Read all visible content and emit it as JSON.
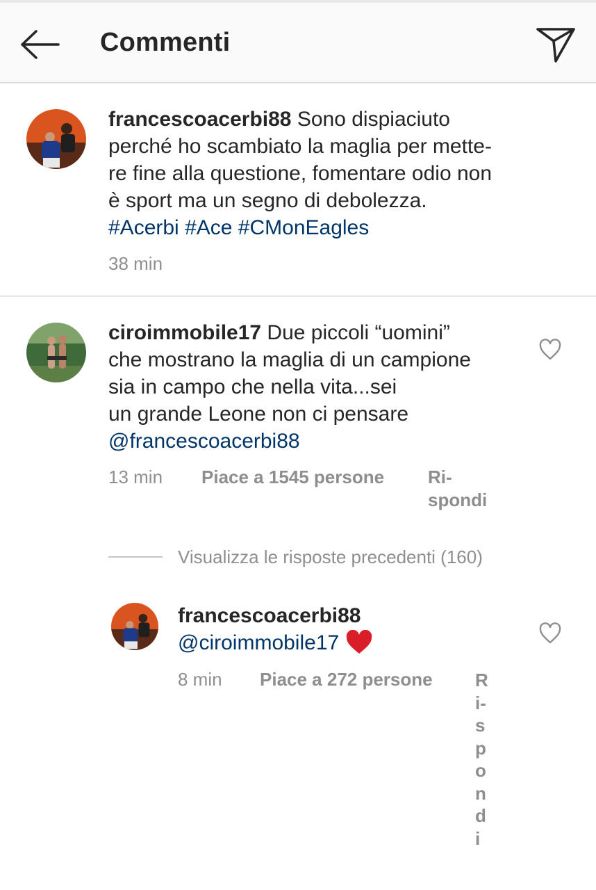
{
  "header": {
    "title": "Commenti"
  },
  "caption": {
    "username": "francescoacerbi88",
    "lines": [
      "Sono dispiaciuto",
      "perché ho scambiato la maglia per mette-",
      "re fine alla questione, fomentare odio non",
      "è sport ma un segno di debolezza."
    ],
    "hashtags": [
      "#Acerbi",
      "#Ace",
      "#CMonEagles"
    ],
    "time": "38 min"
  },
  "comment": {
    "username": "ciroimmobile17",
    "lines": [
      "Due piccoli “uomini”",
      "che mostrano la maglia di un campione",
      "sia in campo che nella vita...sei",
      "un grande Leone non ci pensare"
    ],
    "mention": "@francescoacerbi88",
    "time": "13 min",
    "likes": "Piace a 1545 persone",
    "reply_line1": "Ri-",
    "reply_line2": "spondi"
  },
  "view_replies": "Visualizza le risposte precedenti (160)",
  "reply": {
    "username": "francescoacerbi88",
    "mention": "@ciroimmobile17",
    "emoji": "❤️",
    "time": "8 min",
    "likes": "Piace a 272 persone",
    "reply_label": "Rispondi"
  },
  "colors": {
    "link": "#003569",
    "meta": "#8e8e8e",
    "heart_emoji": "#e0245e"
  }
}
